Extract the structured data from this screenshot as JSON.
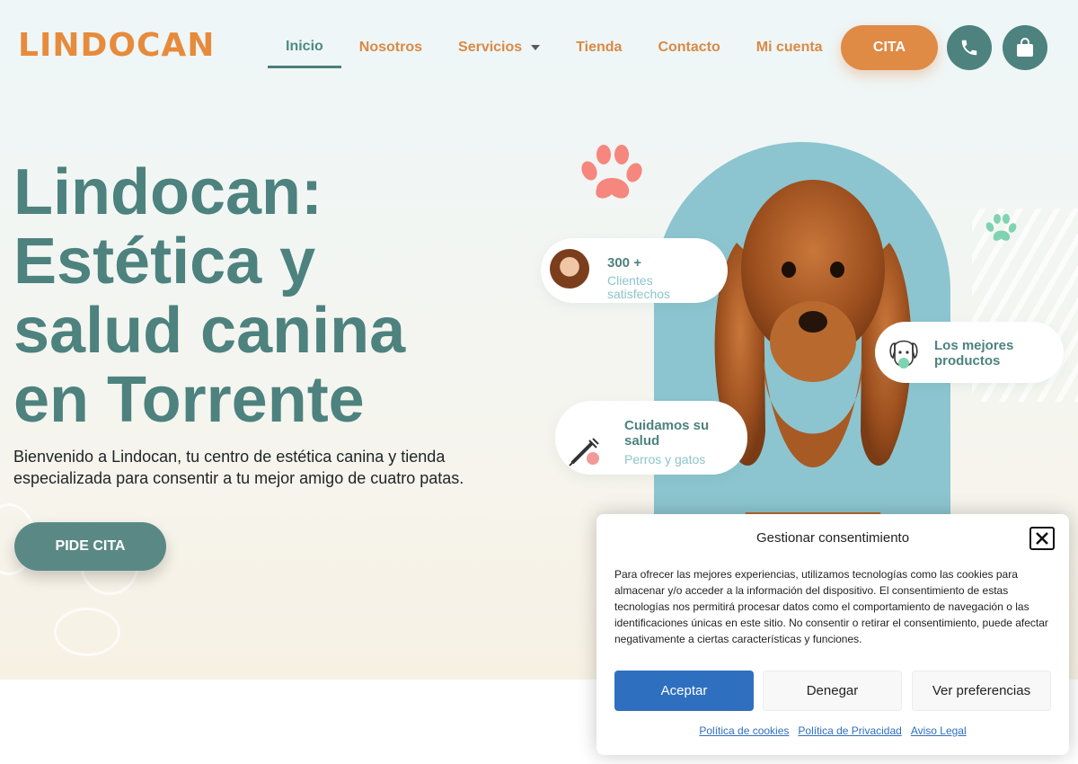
{
  "header": {
    "logo": "LINDOCAN",
    "nav": [
      {
        "label": "Inicio",
        "active": true
      },
      {
        "label": "Nosotros"
      },
      {
        "label": "Servicios",
        "has_dropdown": true
      },
      {
        "label": "Tienda"
      },
      {
        "label": "Contacto"
      },
      {
        "label": "Mi cuenta"
      }
    ],
    "cta_label": "CITA",
    "icons": [
      "phone-icon",
      "shopping-bag-icon"
    ]
  },
  "hero": {
    "title": "Lindocan: Estética y salud canina en Torrente",
    "subtitle": "Bienvenido a Lindocan, tu centro de estética canina y tienda especializada para consentir a tu mejor amigo de cuatro patas.",
    "cta_label": "PIDE CITA"
  },
  "cards": {
    "clients": {
      "count": "300 +",
      "label": "Clientes satisfechos"
    },
    "products": {
      "label": "Los mejores productos"
    },
    "health": {
      "title": "Cuidamos su salud",
      "label": "Perros y gatos"
    }
  },
  "consent": {
    "title": "Gestionar consentimiento",
    "text": "Para ofrecer las mejores experiencias, utilizamos tecnologías como las cookies para almacenar y/o acceder a la información del dispositivo. El consentimiento de estas tecnologías nos permitirá procesar datos como el comportamiento de navegación o las identificaciones únicas en este sitio. No consentir o retirar el consentimiento, puede afectar negativamente a ciertas características y funciones.",
    "accept": "Aceptar",
    "deny": "Denegar",
    "preferences": "Ver preferencias",
    "links": [
      "Política de cookies",
      "Política de Privacidad",
      "Aviso Legal"
    ]
  },
  "colors": {
    "teal": "#4d827e",
    "orange": "#df8a45",
    "blob": "#8cc5cf",
    "accept_blue": "#2f6fbf"
  }
}
